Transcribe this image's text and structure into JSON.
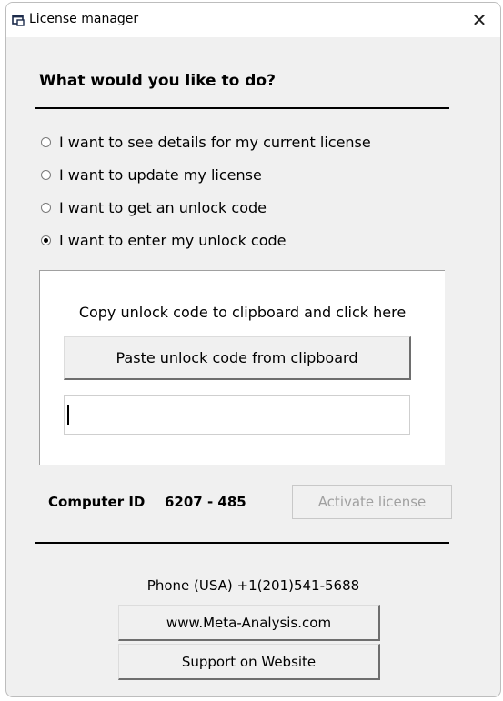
{
  "window": {
    "title": "License manager",
    "close_glyph": "✕",
    "icon": "license-window-icon"
  },
  "main": {
    "heading": "What would you like to do?",
    "options": [
      {
        "label": "I want to see details for my current license",
        "checked": false
      },
      {
        "label": "I want to update my license",
        "checked": false
      },
      {
        "label": "I want to get an unlock code",
        "checked": false
      },
      {
        "label": "I want to enter my unlock code",
        "checked": true
      }
    ]
  },
  "unlock_panel": {
    "instruction": "Copy unlock code to clipboard and click here",
    "paste_button_label": "Paste unlock code from clipboard",
    "code_value": ""
  },
  "footer": {
    "computer_id_label": "Computer ID",
    "computer_id_value": "6207 - 485",
    "activate_label": "Activate license",
    "phone": "Phone (USA) +1(201)541-5688",
    "website_label": "www.Meta-Analysis.com",
    "support_label": "Support on Website"
  },
  "colors": {
    "window_bg": "#f0f0f0",
    "titlebar_bg": "#ffffff",
    "disabled_text": "#a0a0a0"
  }
}
